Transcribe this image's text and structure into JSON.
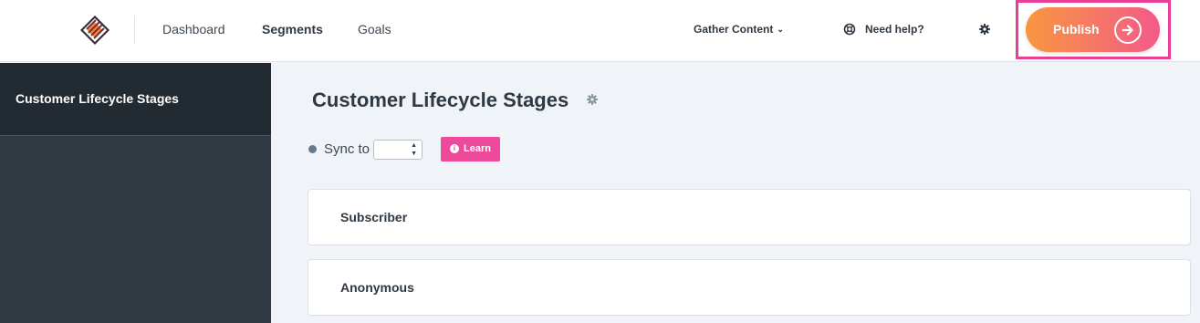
{
  "header": {
    "logo_icon": "layered-stack-logo",
    "nav": [
      {
        "label": "Dashboard",
        "active": false
      },
      {
        "label": "Segments",
        "active": true
      },
      {
        "label": "Goals",
        "active": false
      }
    ],
    "account_label": "Gather Content",
    "account_icon": "chevron-down-icon",
    "help_label": "Need help?",
    "help_icon": "lifebuoy-icon",
    "settings_icon": "gear-icon",
    "publish_label": "Publish",
    "publish_icon": "arrow-right-circle-icon"
  },
  "sidebar": {
    "items": [
      {
        "label": "Customer Lifecycle Stages",
        "active": true
      }
    ]
  },
  "main": {
    "title": "Customer Lifecycle Stages",
    "title_icon": "gear-icon",
    "sync_label": "Sync to",
    "sync_value": "",
    "learn_label": "Learn",
    "learn_icon": "info-icon",
    "stages": [
      {
        "label": "Subscriber"
      },
      {
        "label": "Anonymous"
      }
    ]
  },
  "colors": {
    "accent": "#ee4a9b",
    "publish_gradient_start": "#f8973f",
    "publish_gradient_end": "#f25a8a",
    "highlight_border": "#e83e97",
    "sidebar_bg": "#2f3a43",
    "sidebar_active_bg": "#232b32"
  }
}
